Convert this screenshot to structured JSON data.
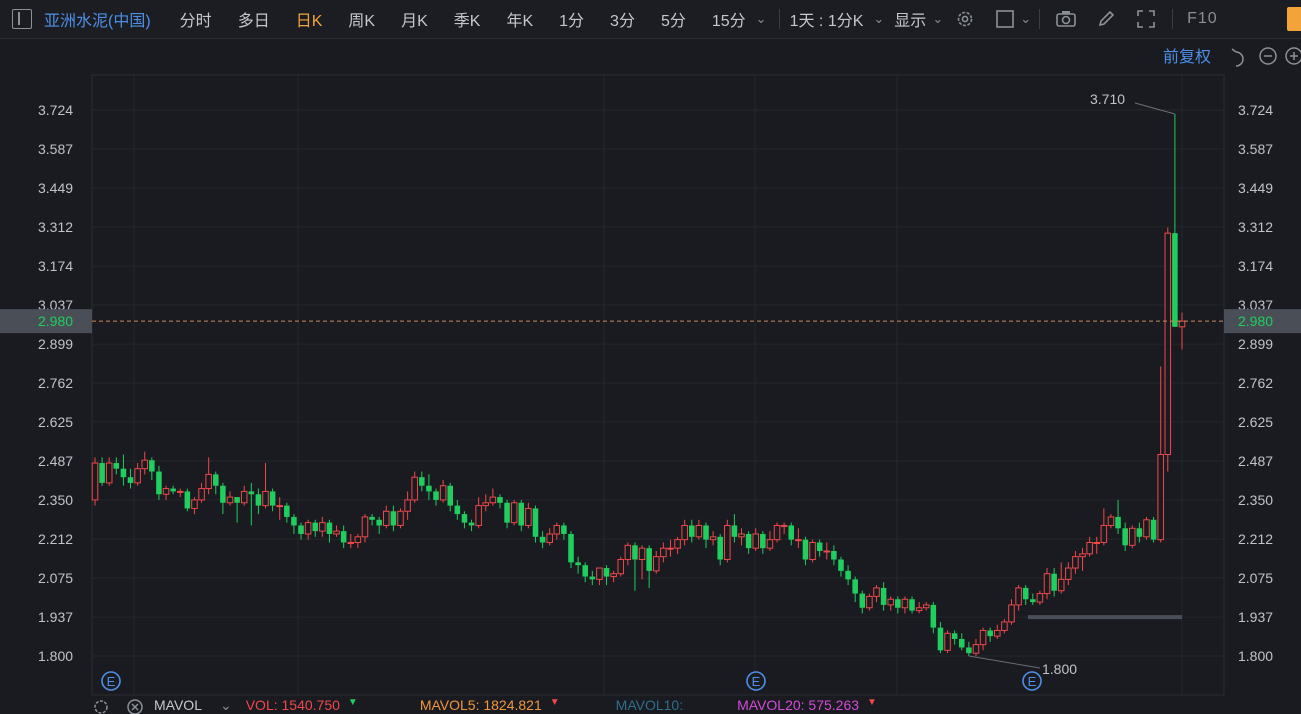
{
  "toolbar": {
    "stock_name": "亚洲水泥(中国)",
    "periods": [
      "分时",
      "多日",
      "日K",
      "周K",
      "月K",
      "季K",
      "年K",
      "1分",
      "3分",
      "5分",
      "15分"
    ],
    "active_period": "日K",
    "timeframe_select": "1天 : 1分K",
    "display_label": "显示",
    "f10_label": "F10"
  },
  "price_adjust_label": "前复权",
  "current_price_tag": "2.980",
  "marker_label": "E",
  "volume_legend": {
    "mavol_label": "MAVOL",
    "vol": "VOL: 1540.750",
    "mavol5": "MAVOL5: 1824.821",
    "mavol10": "MAVOL10:",
    "mavol20": "MAVOL20: 575.263"
  },
  "colors": {
    "up": "#f0484a",
    "down": "#1fce5e",
    "accent": "#f2a33a",
    "link": "#4d8fe6",
    "mavol5": "#f0973a",
    "mavol10": "#2e6d8c",
    "mavol20": "#d44bd8"
  },
  "chart_data": {
    "type": "candlestick",
    "y_ticks": [
      "3.724",
      "3.587",
      "3.449",
      "3.312",
      "3.174",
      "3.037",
      "2.899",
      "2.762",
      "2.625",
      "2.487",
      "2.350",
      "2.212",
      "2.075",
      "1.937",
      "1.800"
    ],
    "ylim": [
      1.8,
      3.724
    ],
    "current_price": 2.98,
    "annotations": [
      {
        "label": "3.710",
        "value": 3.71
      },
      {
        "label": "1.800",
        "value": 1.8
      }
    ],
    "grid": true,
    "candles": [
      [
        2.35,
        2.48,
        2.33,
        2.5
      ],
      [
        2.48,
        2.41,
        2.4,
        2.5
      ],
      [
        2.41,
        2.48,
        2.4,
        2.5
      ],
      [
        2.48,
        2.46,
        2.44,
        2.5
      ],
      [
        2.46,
        2.43,
        2.4,
        2.51
      ],
      [
        2.43,
        2.41,
        2.39,
        2.46
      ],
      [
        2.41,
        2.46,
        2.4,
        2.48
      ],
      [
        2.46,
        2.49,
        2.44,
        2.52
      ],
      [
        2.49,
        2.45,
        2.42,
        2.5
      ],
      [
        2.45,
        2.37,
        2.35,
        2.47
      ],
      [
        2.37,
        2.39,
        2.35,
        2.4
      ],
      [
        2.39,
        2.38,
        2.37,
        2.4
      ],
      [
        2.38,
        2.38,
        2.36,
        2.39
      ],
      [
        2.38,
        2.32,
        2.31,
        2.39
      ],
      [
        2.32,
        2.35,
        2.3,
        2.36
      ],
      [
        2.35,
        2.39,
        2.34,
        2.41
      ],
      [
        2.39,
        2.44,
        2.37,
        2.5
      ],
      [
        2.44,
        2.4,
        2.37,
        2.45
      ],
      [
        2.4,
        2.34,
        2.3,
        2.41
      ],
      [
        2.34,
        2.36,
        2.33,
        2.38
      ],
      [
        2.36,
        2.34,
        2.27,
        2.36
      ],
      [
        2.34,
        2.38,
        2.33,
        2.4
      ],
      [
        2.38,
        2.37,
        2.26,
        2.41
      ],
      [
        2.37,
        2.33,
        2.3,
        2.39
      ],
      [
        2.33,
        2.38,
        2.32,
        2.48
      ],
      [
        2.38,
        2.33,
        2.31,
        2.39
      ],
      [
        2.33,
        2.33,
        2.28,
        2.36
      ],
      [
        2.33,
        2.29,
        2.27,
        2.34
      ],
      [
        2.29,
        2.26,
        2.23,
        2.3
      ],
      [
        2.26,
        2.23,
        2.21,
        2.27
      ],
      [
        2.23,
        2.27,
        2.21,
        2.28
      ],
      [
        2.27,
        2.24,
        2.22,
        2.28
      ],
      [
        2.24,
        2.27,
        2.22,
        2.29
      ],
      [
        2.27,
        2.23,
        2.2,
        2.28
      ],
      [
        2.23,
        2.24,
        2.22,
        2.26
      ],
      [
        2.24,
        2.2,
        2.18,
        2.26
      ],
      [
        2.2,
        2.2,
        2.18,
        2.23
      ],
      [
        2.2,
        2.22,
        2.18,
        2.23
      ],
      [
        2.22,
        2.29,
        2.2,
        2.3
      ],
      [
        2.29,
        2.28,
        2.26,
        2.3
      ],
      [
        2.28,
        2.26,
        2.23,
        2.29
      ],
      [
        2.26,
        2.31,
        2.25,
        2.33
      ],
      [
        2.31,
        2.26,
        2.24,
        2.33
      ],
      [
        2.26,
        2.31,
        2.25,
        2.32
      ],
      [
        2.31,
        2.35,
        2.28,
        2.38
      ],
      [
        2.35,
        2.43,
        2.34,
        2.45
      ],
      [
        2.43,
        2.4,
        2.38,
        2.45
      ],
      [
        2.4,
        2.38,
        2.35,
        2.44
      ],
      [
        2.38,
        2.35,
        2.33,
        2.39
      ],
      [
        2.35,
        2.4,
        2.34,
        2.42
      ],
      [
        2.4,
        2.33,
        2.31,
        2.41
      ],
      [
        2.33,
        2.3,
        2.28,
        2.35
      ],
      [
        2.3,
        2.27,
        2.25,
        2.31
      ],
      [
        2.27,
        2.26,
        2.24,
        2.28
      ],
      [
        2.26,
        2.33,
        2.25,
        2.36
      ],
      [
        2.33,
        2.34,
        2.31,
        2.37
      ],
      [
        2.34,
        2.36,
        2.33,
        2.39
      ],
      [
        2.36,
        2.34,
        2.32,
        2.37
      ],
      [
        2.34,
        2.27,
        2.25,
        2.35
      ],
      [
        2.27,
        2.34,
        2.26,
        2.35
      ],
      [
        2.34,
        2.26,
        2.24,
        2.35
      ],
      [
        2.26,
        2.32,
        2.25,
        2.34
      ],
      [
        2.32,
        2.22,
        2.2,
        2.33
      ],
      [
        2.22,
        2.2,
        2.18,
        2.24
      ],
      [
        2.2,
        2.23,
        2.19,
        2.25
      ],
      [
        2.23,
        2.26,
        2.21,
        2.27
      ],
      [
        2.26,
        2.23,
        2.21,
        2.27
      ],
      [
        2.23,
        2.13,
        2.11,
        2.24
      ],
      [
        2.13,
        2.12,
        2.09,
        2.15
      ],
      [
        2.12,
        2.08,
        2.06,
        2.13
      ],
      [
        2.08,
        2.07,
        2.05,
        2.1
      ],
      [
        2.07,
        2.11,
        2.05,
        2.11
      ],
      [
        2.11,
        2.08,
        2.05,
        2.12
      ],
      [
        2.08,
        2.09,
        2.06,
        2.1
      ],
      [
        2.09,
        2.14,
        2.08,
        2.15
      ],
      [
        2.14,
        2.19,
        2.12,
        2.2
      ],
      [
        2.19,
        2.14,
        2.03,
        2.2
      ],
      [
        2.14,
        2.18,
        2.07,
        2.19
      ],
      [
        2.18,
        2.1,
        2.04,
        2.19
      ],
      [
        2.1,
        2.15,
        2.09,
        2.17
      ],
      [
        2.15,
        2.18,
        2.13,
        2.2
      ],
      [
        2.18,
        2.18,
        2.15,
        2.21
      ],
      [
        2.18,
        2.21,
        2.16,
        2.22
      ],
      [
        2.21,
        2.26,
        2.19,
        2.28
      ],
      [
        2.26,
        2.22,
        2.2,
        2.28
      ],
      [
        2.22,
        2.26,
        2.21,
        2.28
      ],
      [
        2.26,
        2.21,
        2.18,
        2.27
      ],
      [
        2.21,
        2.22,
        2.19,
        2.24
      ],
      [
        2.22,
        2.14,
        2.12,
        2.23
      ],
      [
        2.14,
        2.26,
        2.13,
        2.28
      ],
      [
        2.26,
        2.22,
        2.2,
        2.3
      ],
      [
        2.22,
        2.23,
        2.19,
        2.25
      ],
      [
        2.23,
        2.18,
        2.16,
        2.24
      ],
      [
        2.18,
        2.23,
        2.17,
        2.25
      ],
      [
        2.23,
        2.18,
        2.16,
        2.24
      ],
      [
        2.18,
        2.21,
        2.17,
        2.24
      ],
      [
        2.21,
        2.26,
        2.2,
        2.27
      ],
      [
        2.26,
        2.26,
        2.23,
        2.27
      ],
      [
        2.26,
        2.21,
        2.19,
        2.27
      ],
      [
        2.21,
        2.21,
        2.18,
        2.25
      ],
      [
        2.21,
        2.14,
        2.12,
        2.22
      ],
      [
        2.14,
        2.2,
        2.13,
        2.21
      ],
      [
        2.2,
        2.17,
        2.15,
        2.21
      ],
      [
        2.17,
        2.17,
        2.14,
        2.2
      ],
      [
        2.17,
        2.14,
        2.12,
        2.19
      ],
      [
        2.14,
        2.1,
        2.08,
        2.15
      ],
      [
        2.1,
        2.07,
        2.05,
        2.12
      ],
      [
        2.07,
        2.02,
        1.99,
        2.08
      ],
      [
        2.02,
        1.97,
        1.95,
        2.03
      ],
      [
        1.97,
        2.01,
        1.96,
        2.02
      ],
      [
        2.01,
        2.04,
        1.99,
        2.05
      ],
      [
        2.04,
        1.98,
        1.96,
        2.06
      ],
      [
        1.98,
        2.0,
        1.96,
        2.01
      ],
      [
        2.0,
        1.97,
        1.95,
        2.01
      ],
      [
        1.97,
        2.0,
        1.95,
        2.01
      ],
      [
        2.0,
        1.96,
        1.95,
        2.01
      ],
      [
        1.96,
        1.97,
        1.95,
        1.99
      ],
      [
        1.97,
        1.98,
        1.96,
        1.99
      ],
      [
        1.98,
        1.9,
        1.88,
        1.99
      ],
      [
        1.9,
        1.82,
        1.81,
        1.92
      ],
      [
        1.82,
        1.88,
        1.81,
        1.89
      ],
      [
        1.88,
        1.86,
        1.84,
        1.89
      ],
      [
        1.86,
        1.83,
        1.82,
        1.88
      ],
      [
        1.83,
        1.81,
        1.8,
        1.85
      ],
      [
        1.81,
        1.84,
        1.8,
        1.86
      ],
      [
        1.84,
        1.89,
        1.82,
        1.9
      ],
      [
        1.89,
        1.87,
        1.85,
        1.9
      ],
      [
        1.87,
        1.89,
        1.86,
        1.91
      ],
      [
        1.89,
        1.92,
        1.88,
        1.93
      ],
      [
        1.92,
        1.98,
        1.91,
        2.0
      ],
      [
        1.98,
        2.04,
        1.96,
        2.05
      ],
      [
        2.04,
        2.0,
        1.98,
        2.05
      ],
      [
        2.0,
        1.99,
        1.98,
        2.02
      ],
      [
        1.99,
        2.02,
        1.98,
        2.03
      ],
      [
        2.02,
        2.09,
        2.0,
        2.11
      ],
      [
        2.09,
        2.03,
        2.01,
        2.11
      ],
      [
        2.03,
        2.07,
        2.02,
        2.13
      ],
      [
        2.07,
        2.11,
        2.05,
        2.13
      ],
      [
        2.11,
        2.15,
        2.09,
        2.17
      ],
      [
        2.15,
        2.16,
        2.1,
        2.18
      ],
      [
        2.16,
        2.2,
        2.15,
        2.22
      ],
      [
        2.2,
        2.2,
        2.16,
        2.22
      ],
      [
        2.2,
        2.26,
        2.19,
        2.32
      ],
      [
        2.26,
        2.29,
        2.25,
        2.3
      ],
      [
        2.29,
        2.25,
        2.23,
        2.35
      ],
      [
        2.25,
        2.19,
        2.17,
        2.27
      ],
      [
        2.19,
        2.25,
        2.18,
        2.26
      ],
      [
        2.25,
        2.22,
        2.2,
        2.27
      ],
      [
        2.22,
        2.28,
        2.21,
        2.29
      ],
      [
        2.28,
        2.21,
        2.2,
        2.29
      ],
      [
        2.21,
        2.51,
        2.2,
        2.82
      ],
      [
        2.51,
        3.29,
        2.45,
        3.31
      ],
      [
        3.29,
        2.96,
        2.96,
        3.71
      ],
      [
        2.96,
        2.98,
        2.88,
        3.01
      ]
    ]
  }
}
